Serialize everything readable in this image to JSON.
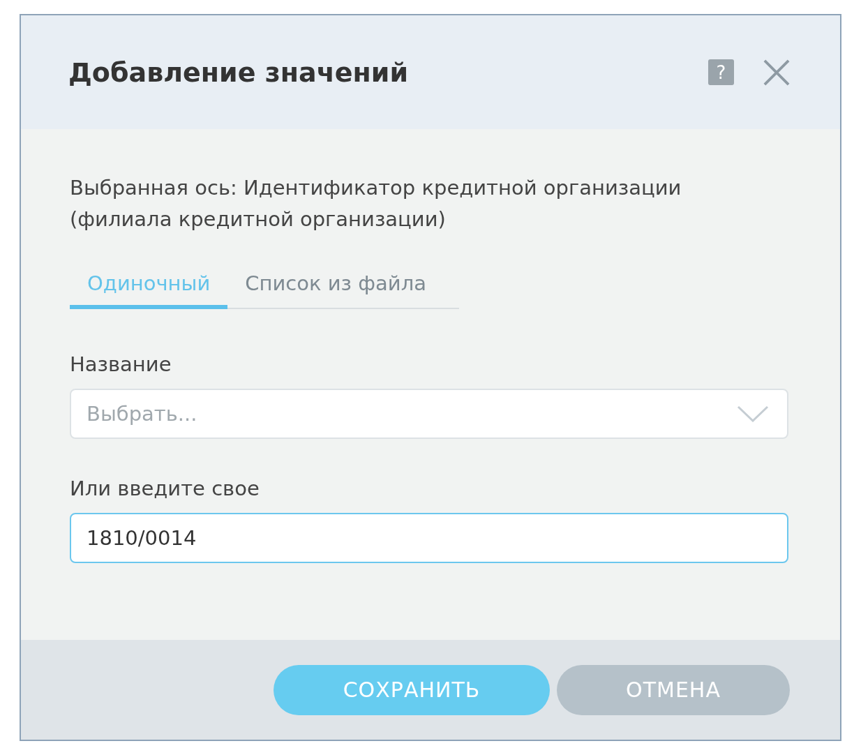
{
  "dialog": {
    "title": "Добавление значений",
    "help": "?"
  },
  "axis_text": "Выбранная ось: Идентификатор кредитной организации (филиала кредитной организации)",
  "tabs": [
    {
      "label": "Одиночный",
      "selected": true
    },
    {
      "label": "Список из файла",
      "selected": false
    }
  ],
  "name_field": {
    "label": "Название",
    "placeholder": "Выбрать..."
  },
  "custom_field": {
    "label": "Или введите свое",
    "value": "1810/0014",
    "focused": true
  },
  "buttons": [
    {
      "label": "СОХРАНИТЬ",
      "kind": "primary"
    },
    {
      "label": "ОТМЕНА",
      "kind": "secondary"
    }
  ]
}
